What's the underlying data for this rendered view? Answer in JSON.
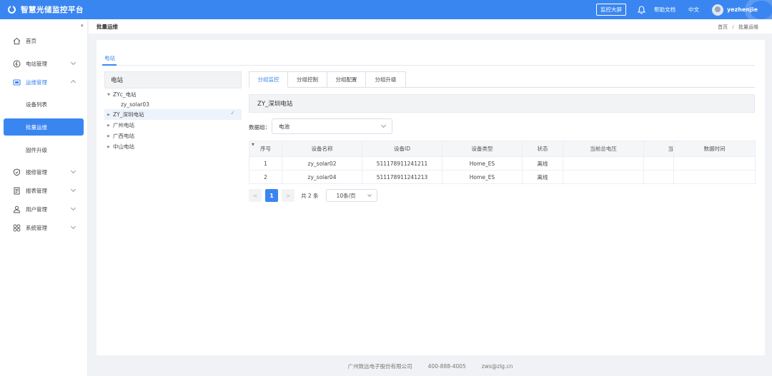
{
  "header": {
    "app_title": "智慧光储监控平台",
    "big_screen_label": "监控大屏",
    "help_label": "帮助文档",
    "lang_label": "中文",
    "username": "yezhenjie"
  },
  "sidebar": {
    "collapse_glyph": "‹‹",
    "items": [
      {
        "label": "首页",
        "icon": "home-icon"
      },
      {
        "label": "电站管理",
        "icon": "power-station-icon"
      },
      {
        "label": "运维管理",
        "icon": "maintenance-icon"
      },
      {
        "label": "报修管理",
        "icon": "shield-icon"
      },
      {
        "label": "报表管理",
        "icon": "report-icon"
      },
      {
        "label": "用户管理",
        "icon": "user-icon"
      },
      {
        "label": "系统管理",
        "icon": "system-icon"
      }
    ],
    "sub_items": [
      {
        "label": "设备列表"
      },
      {
        "label": "批量运维"
      },
      {
        "label": "固件升级"
      }
    ]
  },
  "breadcrumb": {
    "title": "批量运维",
    "home": "首页",
    "separator": "/",
    "current": "批量运维"
  },
  "main": {
    "top_tab": "电站",
    "tree": {
      "header": "电站",
      "nodes": [
        {
          "label": "ZYc_电站",
          "expanded": true
        },
        {
          "label": "zy_solar03"
        },
        {
          "label": "ZY_深圳电站",
          "selected": true
        },
        {
          "label": "广州电站"
        },
        {
          "label": "广西电站"
        },
        {
          "label": "中山电站"
        }
      ]
    },
    "sub_tabs": [
      "分组监控",
      "分组控制",
      "分组配置",
      "分组升级"
    ],
    "station_name": "ZY_深圳电站",
    "data_group_label": "数据组：",
    "data_group_value": "电池",
    "table": {
      "columns": [
        "序号",
        "设备名称",
        "设备ID",
        "设备类型",
        "状态",
        "当前总电压",
        "当",
        "数据时间"
      ],
      "rows": [
        [
          "1",
          "zy_solar02",
          "511178911241211",
          "Home_ES",
          "离线",
          "",
          "",
          ""
        ],
        [
          "2",
          "zy_solar04",
          "511178911241213",
          "Home_ES",
          "离线",
          "",
          "",
          ""
        ]
      ]
    },
    "pagination": {
      "prev": "<",
      "current_page": "1",
      "next": ">",
      "total": "共 2 条",
      "page_size": "10条/页"
    }
  },
  "footer": {
    "company": "广州致远电子股份有限公司",
    "phone": "400-888-4005",
    "email": "zws@zlg.cn"
  },
  "colors": {
    "primary": "#3a86f0",
    "background": "#f0f2f5"
  }
}
